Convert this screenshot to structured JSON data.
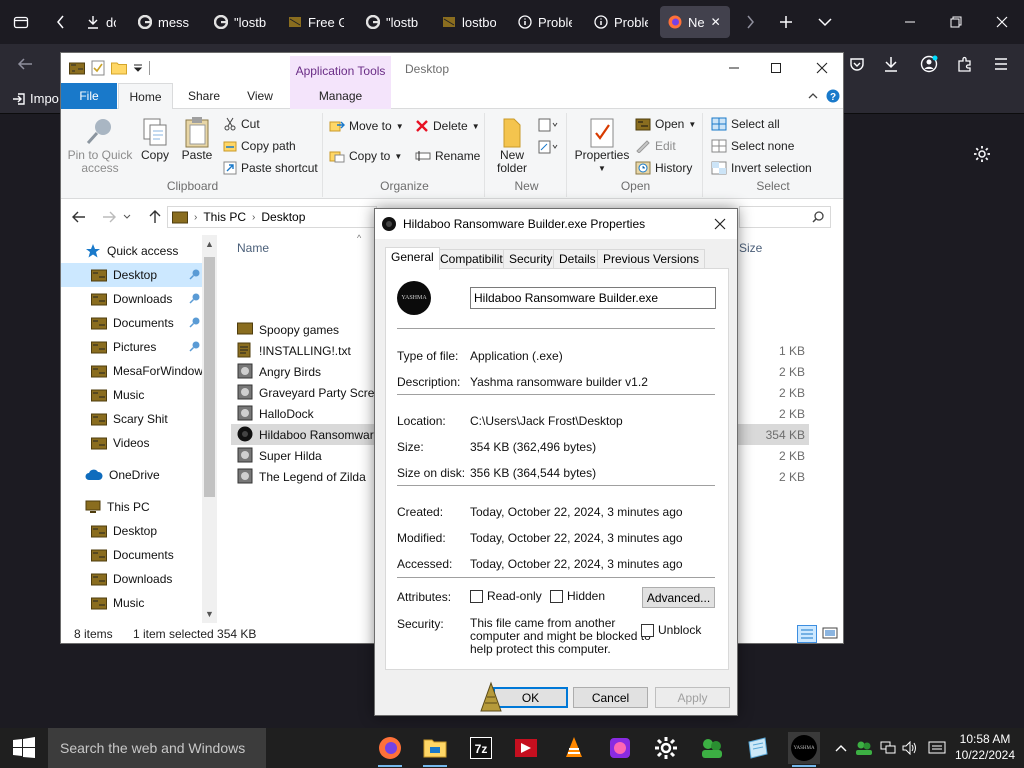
{
  "browser": {
    "tabs": [
      {
        "label": "down",
        "icon": "download-icon"
      },
      {
        "label": "mess",
        "icon": "google-icon"
      },
      {
        "label": "\"lostb",
        "icon": "google-icon"
      },
      {
        "label": "Free G",
        "icon": "site-icon"
      },
      {
        "label": "\"lostb",
        "icon": "google-icon"
      },
      {
        "label": "lostbo",
        "icon": "site-icon"
      },
      {
        "label": "Proble",
        "icon": "info-icon"
      },
      {
        "label": "Proble",
        "icon": "info-icon"
      },
      {
        "label": "Ne",
        "icon": "firefox-icon",
        "active": true
      }
    ],
    "import_bookmarks": "Impo"
  },
  "explorer": {
    "title_location": "Desktop",
    "contextual_tab": "Application Tools",
    "ribbon_tabs": [
      "File",
      "Home",
      "Share",
      "View",
      "Manage"
    ],
    "ribbon": {
      "clipboard": {
        "label": "Clipboard",
        "pin": "Pin to Quick access",
        "copy": "Copy",
        "paste": "Paste",
        "cut": "Cut",
        "copy_path": "Copy path",
        "paste_shortcut": "Paste shortcut"
      },
      "organize": {
        "label": "Organize",
        "move_to": "Move to",
        "copy_to": "Copy to",
        "delete": "Delete",
        "rename": "Rename"
      },
      "new": {
        "label": "New",
        "new_folder": "New folder"
      },
      "open": {
        "label": "Open",
        "properties": "Properties",
        "open": "Open",
        "edit": "Edit",
        "history": "History"
      },
      "select": {
        "label": "Select",
        "select_all": "Select all",
        "select_none": "Select none",
        "invert": "Invert selection"
      }
    },
    "address": {
      "this_pc": "This PC",
      "desktop": "Desktop"
    },
    "nav": [
      {
        "label": "Quick access",
        "icon": "star-icon",
        "indent": 0
      },
      {
        "label": "Desktop",
        "icon": "folder-icon",
        "indent": 1,
        "pinned": true,
        "selected": true
      },
      {
        "label": "Downloads",
        "icon": "folder-icon",
        "indent": 1,
        "pinned": true
      },
      {
        "label": "Documents",
        "icon": "folder-icon",
        "indent": 1,
        "pinned": true
      },
      {
        "label": "Pictures",
        "icon": "folder-icon",
        "indent": 1,
        "pinned": true
      },
      {
        "label": "MesaForWindow",
        "icon": "folder-icon",
        "indent": 1
      },
      {
        "label": "Music",
        "icon": "folder-icon",
        "indent": 1
      },
      {
        "label": "Scary Shit",
        "icon": "folder-icon",
        "indent": 1
      },
      {
        "label": "Videos",
        "icon": "folder-icon",
        "indent": 1
      },
      {
        "label": "OneDrive",
        "icon": "cloud-icon",
        "indent": 0,
        "gap": true
      },
      {
        "label": "This PC",
        "icon": "pc-icon",
        "indent": 0,
        "gap": true
      },
      {
        "label": "Desktop",
        "icon": "folder-icon",
        "indent": 1
      },
      {
        "label": "Documents",
        "icon": "folder-icon",
        "indent": 1
      },
      {
        "label": "Downloads",
        "icon": "folder-icon",
        "indent": 1
      },
      {
        "label": "Music",
        "icon": "folder-icon",
        "indent": 1
      }
    ],
    "columns": {
      "name": "Name",
      "size": "Size"
    },
    "files": [
      {
        "name": "Spoopy games",
        "size": "",
        "icon": "folder-icon"
      },
      {
        "name": "!INSTALLING!.txt",
        "size": "1 KB",
        "icon": "text-file-icon"
      },
      {
        "name": "Angry Birds",
        "size": "2 KB",
        "icon": "app-icon"
      },
      {
        "name": "Graveyard Party Screen",
        "size": "2 KB",
        "icon": "app-icon"
      },
      {
        "name": "HalloDock",
        "size": "2 KB",
        "icon": "app-icon"
      },
      {
        "name": "Hildaboo Ransomware",
        "size": "354 KB",
        "icon": "exe-icon",
        "selected": true
      },
      {
        "name": "Super Hilda",
        "size": "2 KB",
        "icon": "app-icon"
      },
      {
        "name": "The Legend of Zilda",
        "size": "2 KB",
        "icon": "app-icon"
      }
    ],
    "status": {
      "count": "8 items",
      "selection": "1 item selected  354 KB"
    }
  },
  "props": {
    "title": "Hildaboo Ransomware Builder.exe Properties",
    "tabs": [
      "General",
      "Compatibility",
      "Security",
      "Details",
      "Previous Versions"
    ],
    "filename": "Hildaboo Ransomware Builder.exe",
    "icon_text": "YASHMA",
    "rows1": [
      {
        "label": "Type of file:",
        "value": "Application (.exe)"
      },
      {
        "label": "Description:",
        "value": "Yashma ransomware builder v1.2"
      }
    ],
    "rows2": [
      {
        "label": "Location:",
        "value": "C:\\Users\\Jack Frost\\Desktop"
      },
      {
        "label": "Size:",
        "value": "354 KB (362,496 bytes)"
      },
      {
        "label": "Size on disk:",
        "value": "356 KB (364,544 bytes)"
      }
    ],
    "rows3": [
      {
        "label": "Created:",
        "value": "Today, October 22, 2024, 3 minutes ago"
      },
      {
        "label": "Modified:",
        "value": "Today, October 22, 2024, 3 minutes ago"
      },
      {
        "label": "Accessed:",
        "value": "Today, October 22, 2024, 3 minutes ago"
      }
    ],
    "attributes": {
      "label": "Attributes:",
      "readonly": "Read-only",
      "hidden": "Hidden",
      "advanced": "Advanced..."
    },
    "security": {
      "label": "Security:",
      "line1": "This file came from another",
      "line2": "computer and might be blocked to",
      "line3": "help protect this computer.",
      "unblock": "Unblock"
    },
    "buttons": {
      "ok": "OK",
      "cancel": "Cancel",
      "apply": "Apply"
    }
  },
  "taskbar": {
    "search": "Search the web and Windows",
    "time": "10:58 AM",
    "date": "10/22/2024",
    "tray_yashma": "YASHMA"
  }
}
